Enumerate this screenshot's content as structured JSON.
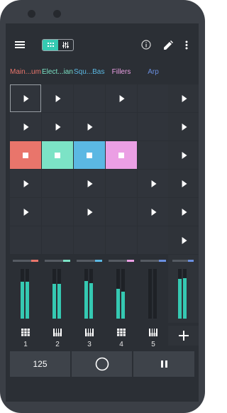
{
  "toolbar": {
    "menu_icon": "hamburger-icon",
    "mode_toggle": [
      "grid-icon",
      "mixer-sliders-icon"
    ],
    "actions": [
      "info-icon",
      "edit-pencil-icon",
      "more-vertical-icon"
    ]
  },
  "tracks": [
    {
      "label": "Main...ums",
      "color": "#e9756b",
      "number": "1",
      "type_icon": "drum-pad-icon",
      "level": [
        0.74,
        0.74
      ]
    },
    {
      "label": "Elect...iano",
      "color": "#7ce3c6",
      "number": "2",
      "type_icon": "piano-keys-icon",
      "level": [
        0.7,
        0.7
      ]
    },
    {
      "label": "Squ...Bass",
      "color": "#5bb8e3",
      "number": "3",
      "type_icon": "piano-keys-icon",
      "level": [
        0.76,
        0.72
      ]
    },
    {
      "label": "Fillers",
      "color": "#eb9fe4",
      "number": "4",
      "type_icon": "drum-pad-icon",
      "level": [
        0.6,
        0.54
      ]
    },
    {
      "label": "Arp",
      "color": "#6a8fe0",
      "number": "5",
      "type_icon": "piano-keys-icon",
      "level": [
        0.0,
        0.0
      ]
    }
  ],
  "grid": [
    [
      "play",
      "play",
      "empty",
      "play",
      "empty"
    ],
    [
      "play",
      "play",
      "play",
      "empty",
      "empty"
    ],
    [
      "stop",
      "stop",
      "stop",
      "stop",
      "empty"
    ],
    [
      "play",
      "empty",
      "play",
      "empty",
      "play"
    ],
    [
      "play",
      "empty",
      "play",
      "empty",
      "play"
    ],
    [
      "empty",
      "empty",
      "empty",
      "empty",
      "empty"
    ]
  ],
  "scene_launchers": [
    "play",
    "play",
    "play",
    "play",
    "play",
    "play"
  ],
  "master": {
    "level": [
      0.8,
      0.82
    ],
    "add_icon": "plus-icon"
  },
  "bottom_bar": {
    "tempo": "125",
    "record_icon": "record-circle-icon",
    "pause_icon": "pause-icon"
  }
}
